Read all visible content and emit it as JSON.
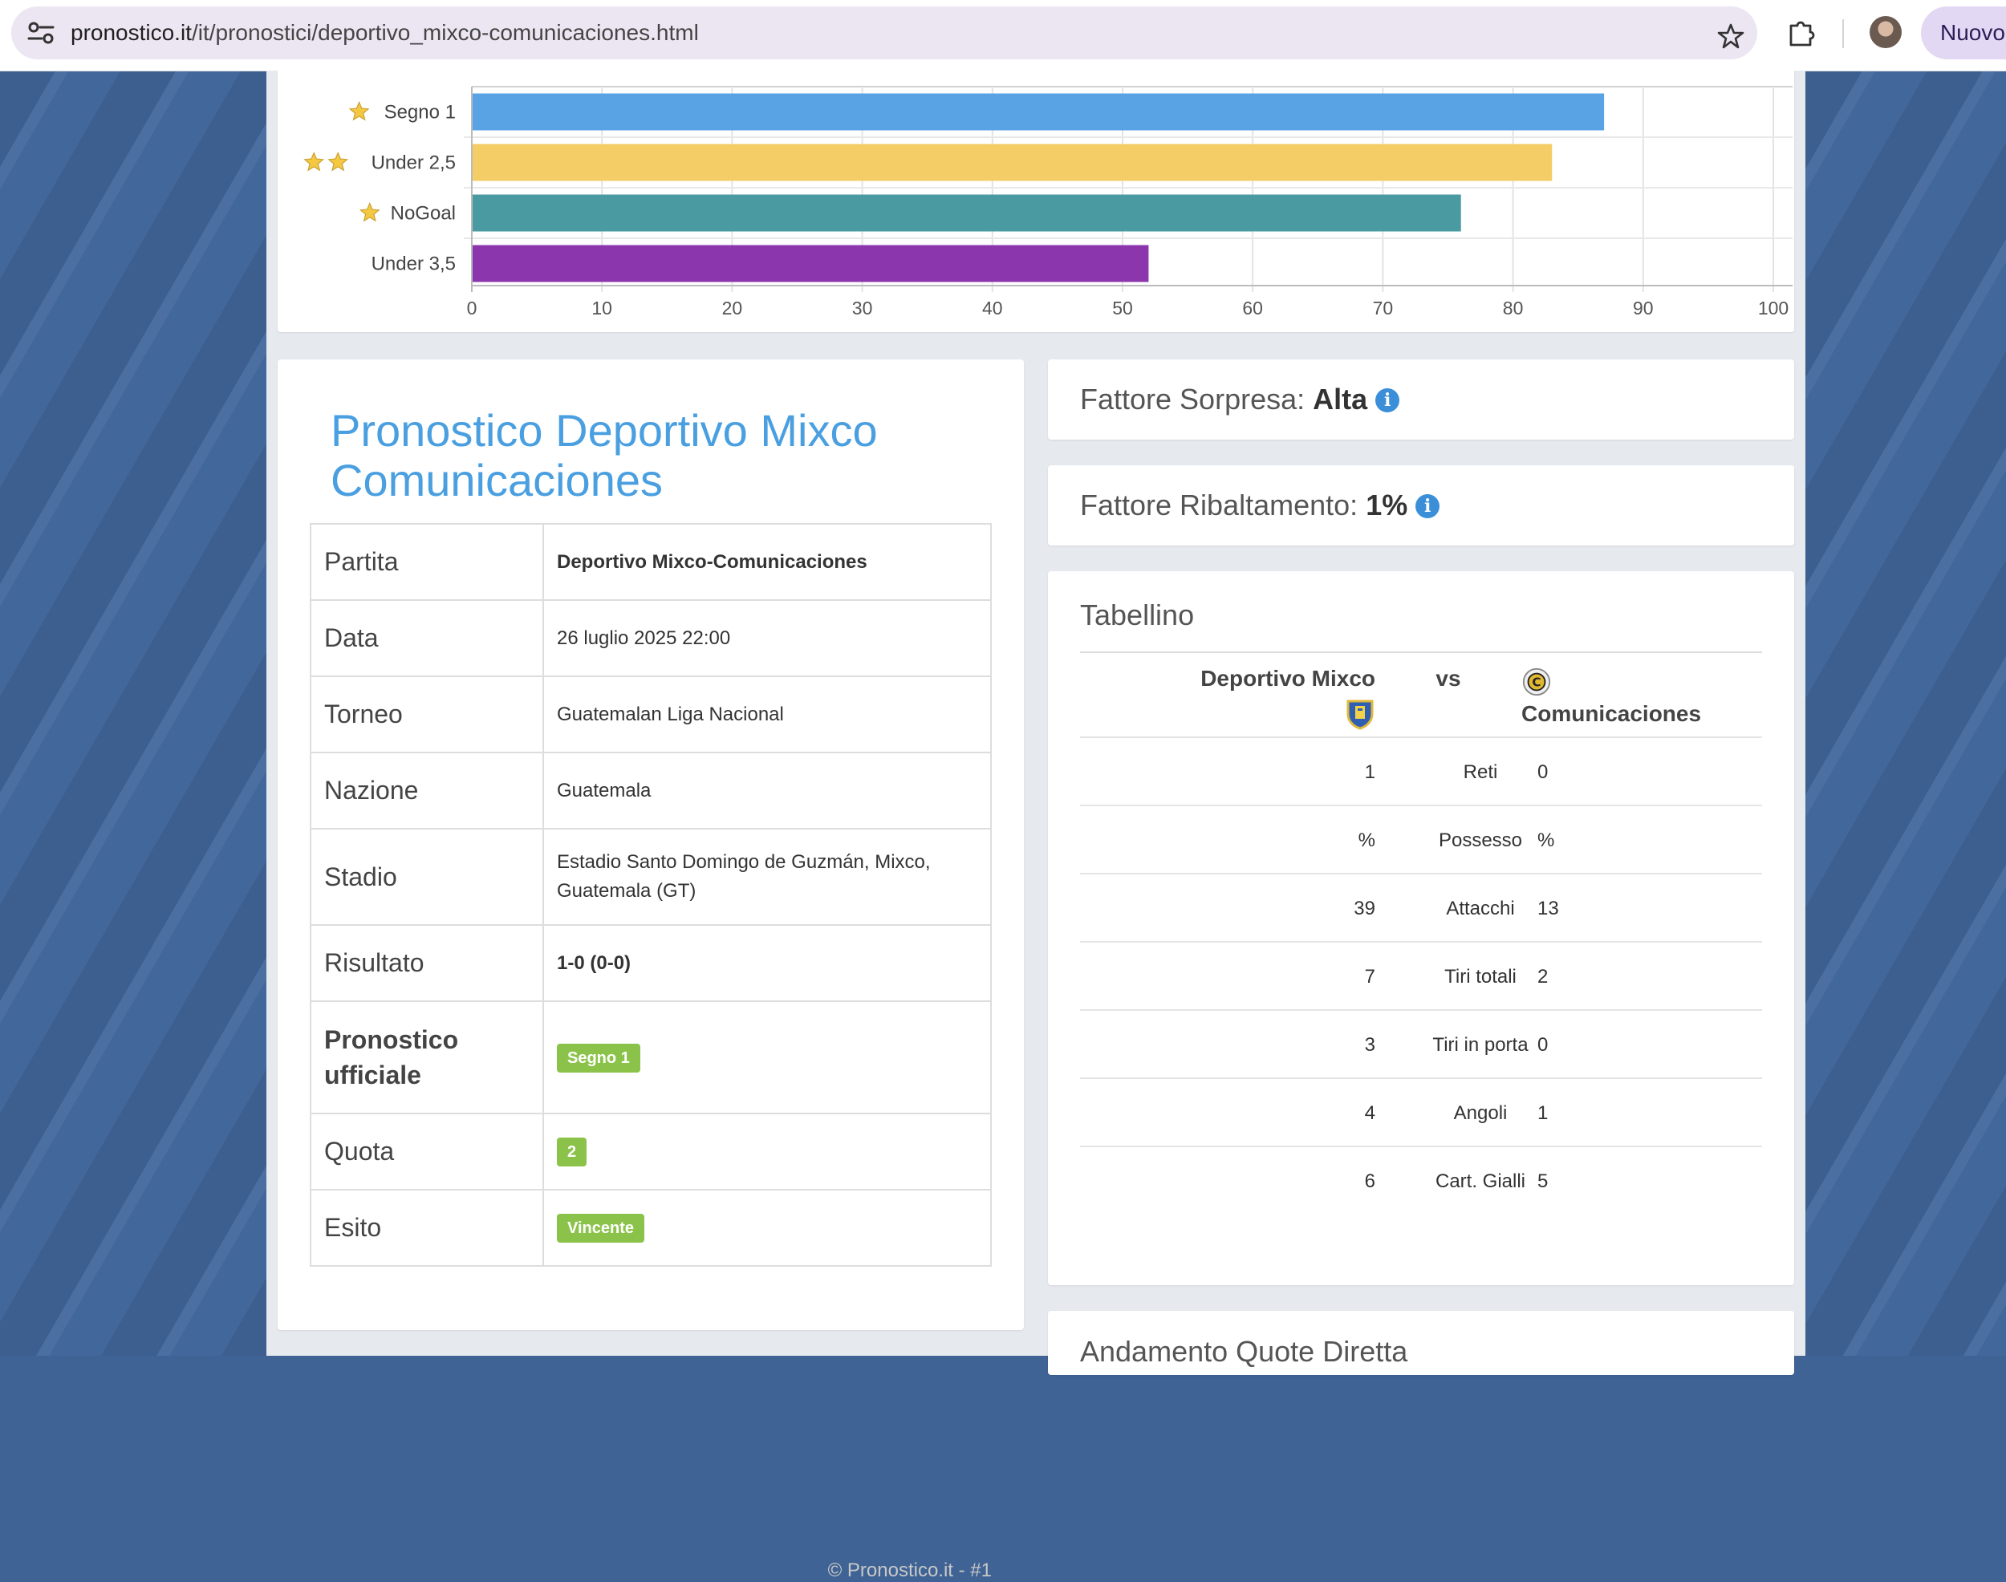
{
  "browser": {
    "url_host": "pronostico.it",
    "url_path": "/it/pronostici/deportivo_mixco-comunicaciones.html",
    "new_button": "Nuovo"
  },
  "chart_data": {
    "type": "bar",
    "orientation": "horizontal",
    "categories": [
      "Segno 1",
      "Under 2,5",
      "NoGoal",
      "Under 3,5"
    ],
    "category_stars": [
      1,
      2,
      1,
      0
    ],
    "values": [
      87,
      83,
      76,
      52
    ],
    "colors": [
      "#59a3e4",
      "#f5cd66",
      "#4a9aa1",
      "#8b36ad"
    ],
    "xlim": [
      0,
      100
    ],
    "xticks": [
      0,
      10,
      20,
      30,
      40,
      50,
      60,
      70,
      80,
      90,
      100
    ],
    "grid": true
  },
  "info": {
    "title": "Pronostico Deportivo Mixco Comunicaciones",
    "rows": {
      "partita": {
        "label": "Partita",
        "value": "Deportivo Mixco-Comunicaciones"
      },
      "data": {
        "label": "Data",
        "value": "26 luglio 2025 22:00"
      },
      "torneo": {
        "label": "Torneo",
        "value": "Guatemalan Liga Nacional"
      },
      "nazione": {
        "label": "Nazione",
        "value": "Guatemala"
      },
      "stadio": {
        "label": "Stadio",
        "value": "Estadio Santo Domingo de Guzmán, Mixco, Guatemala (GT)"
      },
      "risultato": {
        "label": "Risultato",
        "value": "1-0 (0-0)"
      },
      "pronostico": {
        "label": "Pronostico ufficiale",
        "value": "Segno 1"
      },
      "quota": {
        "label": "Quota",
        "value": "2"
      },
      "esito": {
        "label": "Esito",
        "value": "Vincente"
      }
    },
    "footer": "© Pronostico.it - #1"
  },
  "factors": {
    "sorpresa": {
      "label": "Fattore Sorpresa:",
      "value": "Alta"
    },
    "ribaltamento": {
      "label": "Fattore Ribaltamento:",
      "value": "1%"
    }
  },
  "tabellino": {
    "title": "Tabellino",
    "home_team": "Deportivo Mixco",
    "vs": "vs",
    "away_team": "Comunicaciones",
    "stats": [
      {
        "home": "1",
        "name": "Reti",
        "away": "0"
      },
      {
        "home": "%",
        "name": "Possesso",
        "away": "%"
      },
      {
        "home": "39",
        "name": "Attacchi",
        "away": "13"
      },
      {
        "home": "7",
        "name": "Tiri totali",
        "away": "2"
      },
      {
        "home": "3",
        "name": "Tiri in porta",
        "away": "0"
      },
      {
        "home": "4",
        "name": "Angoli",
        "away": "1"
      },
      {
        "home": "6",
        "name": "Cart. Gialli",
        "away": "5"
      }
    ]
  },
  "quote_section": {
    "title": "Andamento Quote Diretta"
  }
}
